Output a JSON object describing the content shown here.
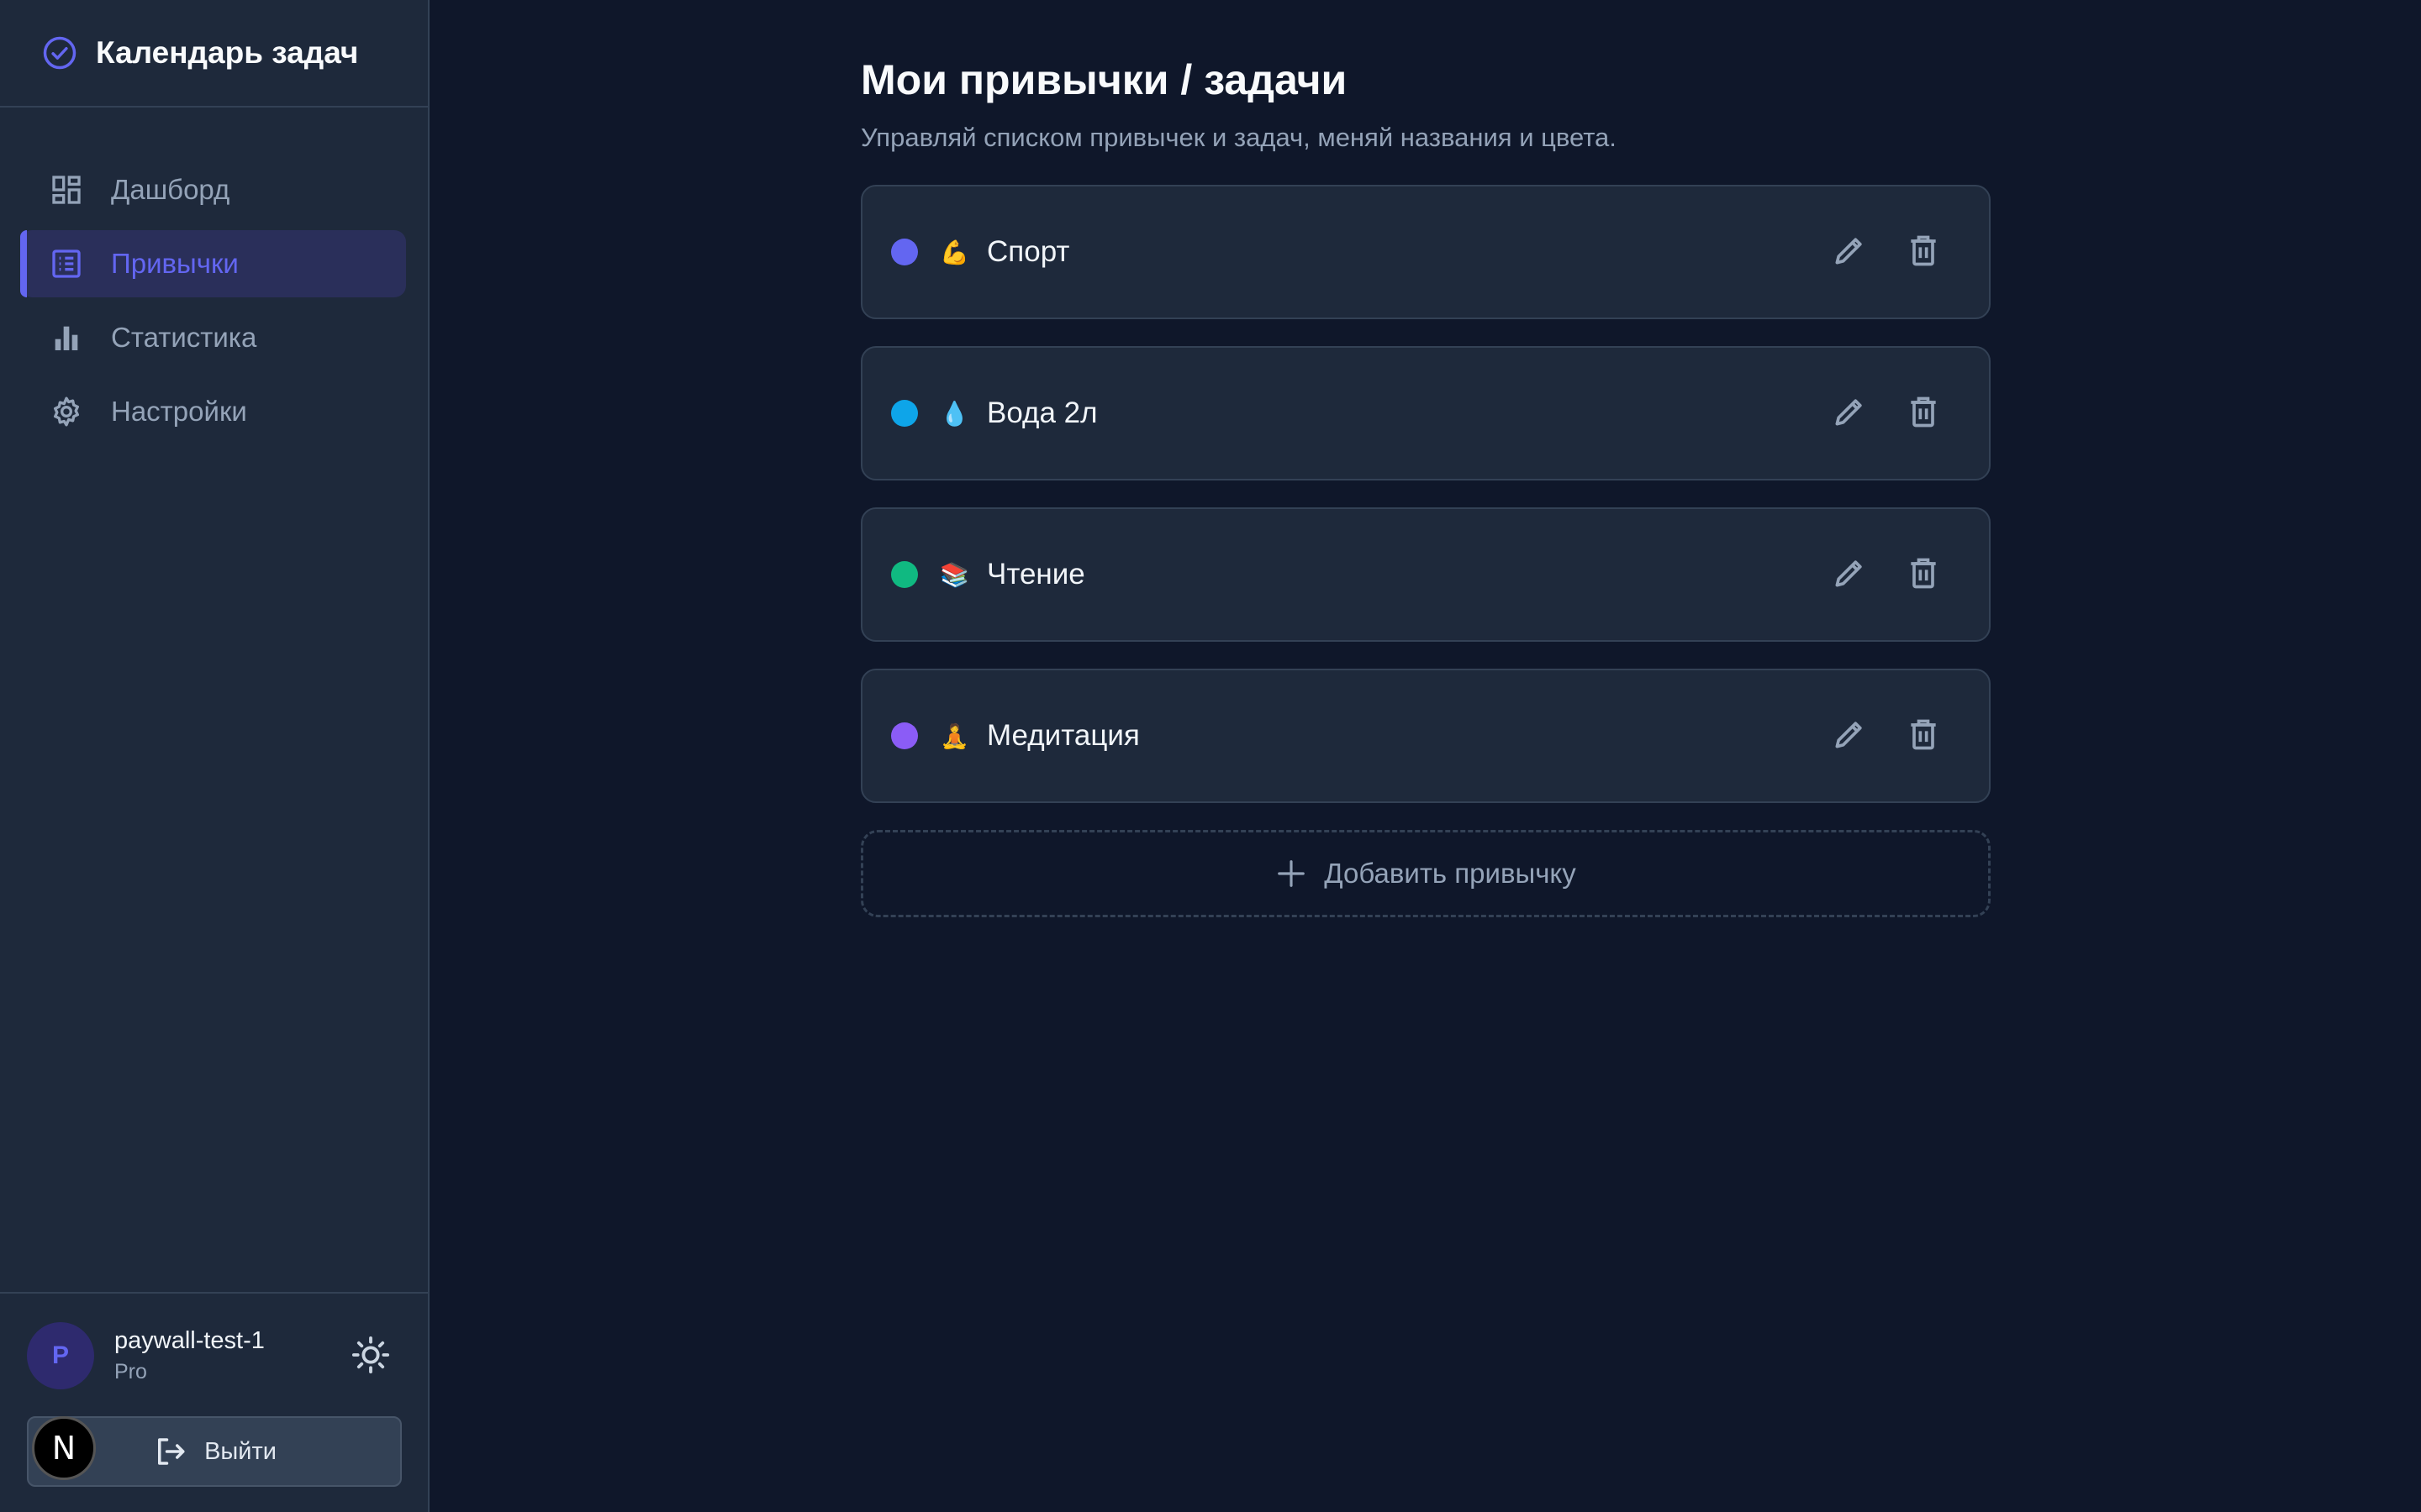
{
  "app": {
    "title": "Календарь задач"
  },
  "sidebar": {
    "items": [
      {
        "label": "Дашборд",
        "icon": "dashboard-icon",
        "active": false
      },
      {
        "label": "Привычки",
        "icon": "list-icon",
        "active": true
      },
      {
        "label": "Статистика",
        "icon": "bar-chart-icon",
        "active": false
      },
      {
        "label": "Настройки",
        "icon": "gear-icon",
        "active": false
      }
    ],
    "user": {
      "initial": "P",
      "name": "paywall-test-1",
      "plan": "Pro"
    },
    "logout_label": "Выйти",
    "next_badge": "N"
  },
  "main": {
    "title": "Мои привычки / задачи",
    "subtitle": "Управляй списком привычек и задач, меняй названия и цвета.",
    "habits": [
      {
        "name": "Спорт",
        "emoji": "💪",
        "color": "#6366f1"
      },
      {
        "name": "Вода 2л",
        "emoji": "💧",
        "color": "#0ea5e9"
      },
      {
        "name": "Чтение",
        "emoji": "📚",
        "color": "#10b981"
      },
      {
        "name": "Медитация",
        "emoji": "🧘",
        "color": "#8b5cf6"
      }
    ],
    "add_label": "Добавить привычку"
  },
  "colors": {
    "background": "#0f172a",
    "sidebar": "#1e293b",
    "accent": "#6366f1",
    "muted": "#94a3b8"
  }
}
